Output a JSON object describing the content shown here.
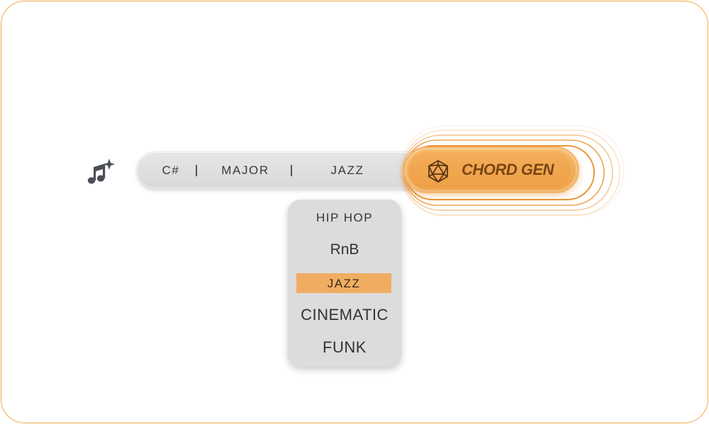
{
  "colors": {
    "accent": "#efa24a",
    "frame_border": "#f3a74a",
    "bar_bg": "#dfdfdf",
    "dropdown_bg": "#dcdcdc",
    "selected_bg": "#f0ad62",
    "text": "#333333",
    "button_text": "#7a4514"
  },
  "app_icon": {
    "icon": "music-notes-sparkle-icon"
  },
  "selector": {
    "key": "C#",
    "separator_1": "|",
    "scale": "MAJOR",
    "separator_2": "|",
    "genre": "JAZZ"
  },
  "generate_button": {
    "icon": "icosahedron-dice-icon",
    "label": "CHORD GEN"
  },
  "genre_dropdown": {
    "selected": "JAZZ",
    "options": [
      "HIP HOP",
      "RnB",
      "JAZZ",
      "CINEMATIC",
      "FUNK"
    ]
  }
}
